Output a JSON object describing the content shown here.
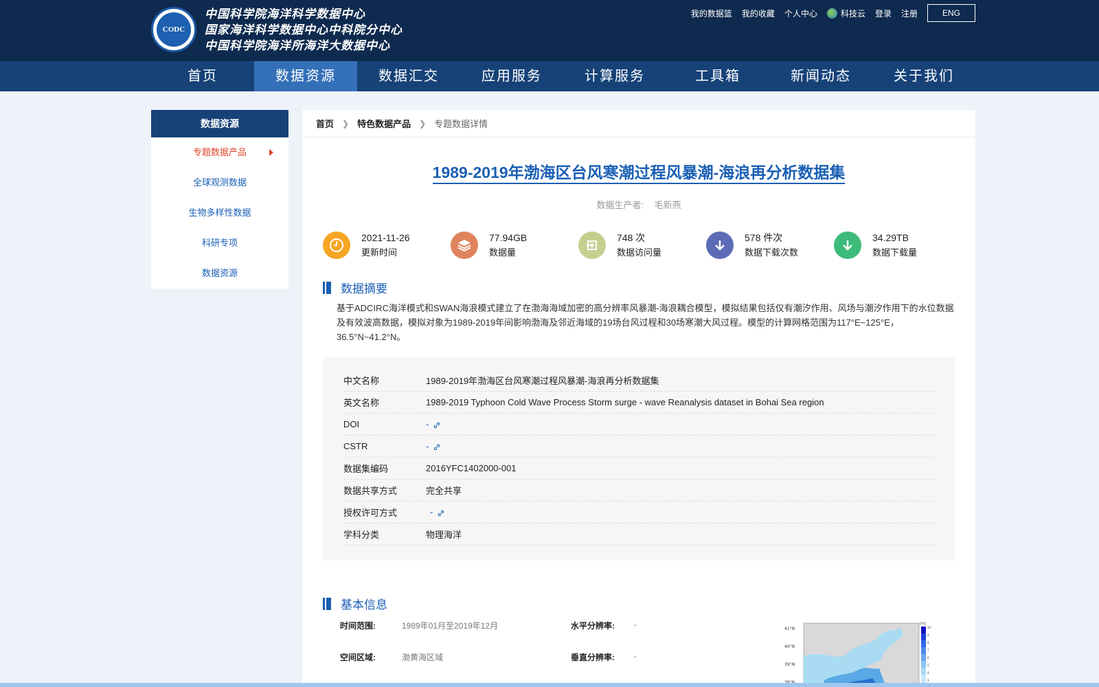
{
  "header": {
    "logo_text": "CODC",
    "org_names": [
      "中国科学院海洋科学数据中心",
      "国家海洋科学数据中心中科院分中心",
      "中国科学院海洋所海洋大数据中心"
    ],
    "top_links": [
      "我的数据篮",
      "我的收藏",
      "个人中心",
      "科技云",
      "登录",
      "注册"
    ],
    "lang": "ENG"
  },
  "nav": [
    "首页",
    "数据资源",
    "数据汇交",
    "应用服务",
    "计算服务",
    "工具箱",
    "新闻动态",
    "关于我们"
  ],
  "sidebar": {
    "title": "数据资源",
    "items": [
      "专题数据产品",
      "全球观测数据",
      "生物多样性数据",
      "科研专项",
      "数据资源"
    ]
  },
  "breadcrumb": [
    "首页",
    "特色数据产品",
    "专题数据详情"
  ],
  "dataset": {
    "title": "1989-2019年渤海区台风寒潮过程风暴潮-海浪再分析数据集",
    "producer_label": "数据生产者:",
    "producer": "毛新燕"
  },
  "stats": [
    {
      "value": "2021-11-26",
      "label": "更新时间",
      "icon": "clock-icon",
      "color": "#f6a623"
    },
    {
      "value": "77.94GB",
      "label": "数据量",
      "icon": "layers-icon",
      "color": "#e0845e"
    },
    {
      "value": "748 次",
      "label": "数据访问量",
      "icon": "login-icon",
      "color": "#c5cf8f"
    },
    {
      "value": "578 件次",
      "label": "数据下载次数",
      "icon": "download-icon",
      "color": "#5b6bb5"
    },
    {
      "value": "34.29TB",
      "label": "数据下载量",
      "icon": "download-icon",
      "color": "#3dbb7a"
    }
  ],
  "summary": {
    "heading": "数据摘要",
    "text": "基于ADCIRC海洋模式和SWAN海浪模式建立了在渤海海域加密的高分辨率风暴潮-海浪耦合模型，模拟结果包括仅有潮汐作用、风场与潮汐作用下的水位数据及有效波高数据，模拟对象为1989-2019年间影响渤海及邻近海域的19场台风过程和30场寒潮大风过程。模型的计算网格范围为117°E~125°E，36.5°N~41.2°N。"
  },
  "info": [
    {
      "key": "中文名称",
      "value": "1989-2019年渤海区台风寒潮过程风暴潮-海浪再分析数据集",
      "link": false
    },
    {
      "key": "英文名称",
      "value": "1989-2019 Typhoon Cold Wave Process Storm surge - wave Reanalysis dataset in Bohai Sea region",
      "link": false
    },
    {
      "key": "DOI",
      "value": "-",
      "link": true
    },
    {
      "key": "CSTR",
      "value": "-",
      "link": true
    },
    {
      "key": "数据集编码",
      "value": "2016YFC1402000-001",
      "link": false
    },
    {
      "key": "数据共享方式",
      "value": "完全共享",
      "link": false
    },
    {
      "key": "授权许可方式",
      "value": "-",
      "link": true
    },
    {
      "key": "学科分类",
      "value": "物理海洋",
      "link": false
    }
  ],
  "basic_info": {
    "heading": "基本信息",
    "time_range_label": "时间范围:",
    "time_range": "1989年01月至2019年12月",
    "h_res_label": "水平分辨率:",
    "h_res": "-",
    "region_label": "空间区域:",
    "region": "渤黄海区域",
    "v_res_label": "垂直分辨率:",
    "v_res": "-"
  },
  "map": {
    "unit": "[m]",
    "lat_labels": [
      "41°N",
      "40°N",
      "39°N",
      "38°N"
    ],
    "scale_labels": [
      "10",
      "9",
      "8",
      "7",
      "6",
      "5",
      "4",
      "3"
    ]
  }
}
